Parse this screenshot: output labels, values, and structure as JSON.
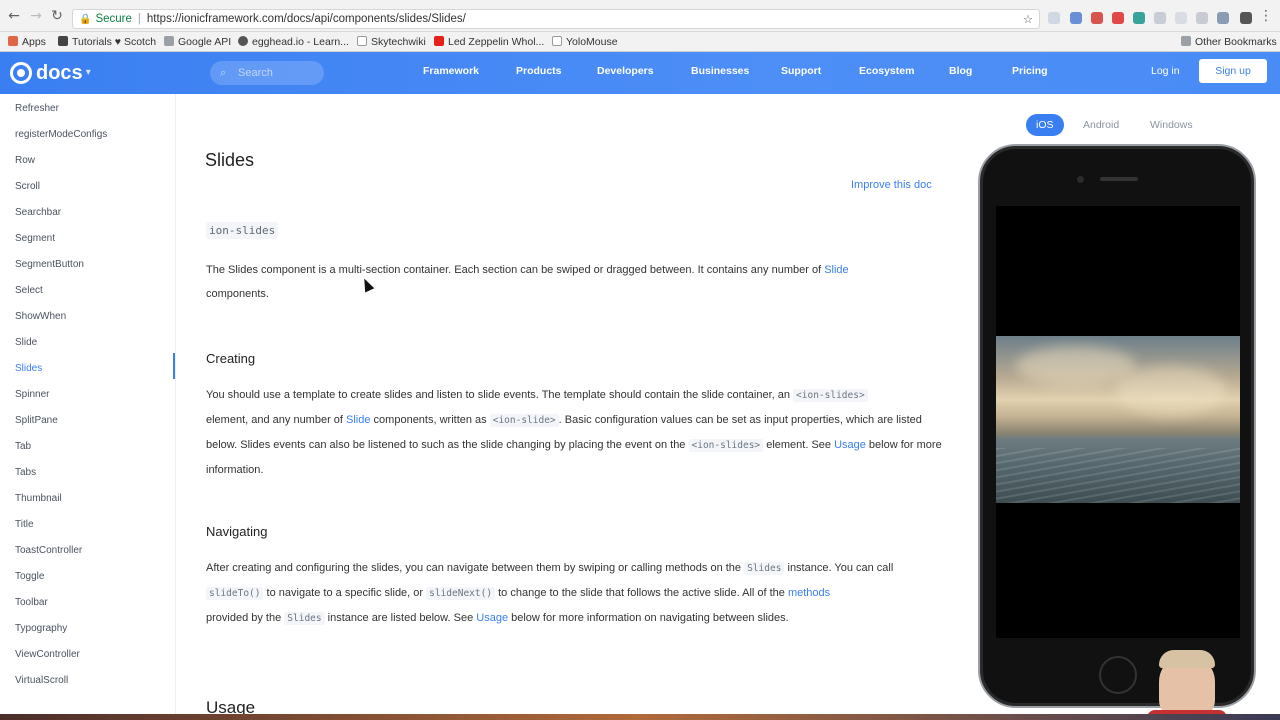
{
  "browser": {
    "secure_label": "Secure",
    "url": "https://ionicframework.com/docs/api/components/slides/Slides/",
    "bookmarks": [
      "Apps",
      "Tutorials ♥ Scotch",
      "Google API",
      "egghead.io - Learn...",
      "Skytechwiki",
      "Led Zeppelin Whol...",
      "YoloMouse"
    ],
    "other_bookmarks": "Other Bookmarks"
  },
  "header": {
    "logo": "docs",
    "search_placeholder": "Search",
    "nav": [
      "Framework",
      "Products",
      "Developers",
      "Businesses",
      "Support",
      "Ecosystem",
      "Blog",
      "Pricing"
    ],
    "login": "Log in",
    "signup": "Sign up"
  },
  "sidebar": {
    "items": [
      "Refresher",
      "registerModeConfigs",
      "Row",
      "Scroll",
      "Searchbar",
      "Segment",
      "SegmentButton",
      "Select",
      "ShowWhen",
      "Slide",
      "Slides",
      "Spinner",
      "SplitPane",
      "Tab",
      "Tabs",
      "Thumbnail",
      "Title",
      "ToastController",
      "Toggle",
      "Toolbar",
      "Typography",
      "ViewController",
      "VirtualScroll"
    ],
    "active": "Slides"
  },
  "content": {
    "title": "Slides",
    "improve": "Improve this doc",
    "tag": "ion-slides",
    "intro_1": "The Slides component is a multi-section container. Each section can be swiped or dragged between. It contains any number of ",
    "intro_link": "Slide",
    "intro_2": "components.",
    "creating_heading": "Creating",
    "creating": {
      "t1": "You should use a template to create slides and listen to slide events. The template should contain the slide container, an ",
      "c1": "<ion-slides>",
      "t2": "element, and any number of ",
      "l1": "Slide",
      "t3": " components, written as ",
      "c2": "<ion-slide>",
      "t4": ". Basic configuration values can be set as input properties, which are listed below. Slides events can also be listened to such as the slide changing by placing the event on the ",
      "c3": "<ion-slides>",
      "t5": " element. See ",
      "l2": "Usage",
      "t6": " below for more information."
    },
    "navigating_heading": "Navigating",
    "navigating": {
      "t1": "After creating and configuring the slides, you can navigate between them by swiping or calling methods on the ",
      "c1": "Slides",
      "t2": " instance. You can call ",
      "c2": "slideTo()",
      "t3": " to navigate to a specific slide, or ",
      "c3": "slideNext()",
      "t4": " to change to the slide that follows the active slide. All of the ",
      "l1": "methods",
      "t5": "provided by the ",
      "c4": "Slides",
      "t6": " instance are listed below. See ",
      "l2": "Usage",
      "t7": " below for more information on navigating between slides."
    },
    "next_heading": "Usage"
  },
  "preview": {
    "platforms": [
      "iOS",
      "Android",
      "Windows"
    ],
    "active_platform": "iOS"
  },
  "colors": {
    "accent": "#3a7ff2",
    "header": "#4a8cf5"
  }
}
